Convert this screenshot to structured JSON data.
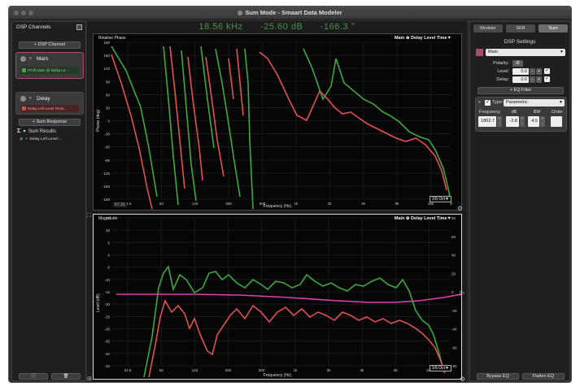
{
  "window": {
    "title": "Sum Mode - Smaart Data Modeler"
  },
  "left_panel": {
    "title": "DSP Channels",
    "add_channel_label": "+ DSP Channel",
    "channels": [
      {
        "name": "Main",
        "source": "(Trsf) Main @ Delay Le...",
        "color": "#3fa83f"
      },
      {
        "name": "Delay",
        "source": "Delay Left Level Timin...",
        "color": "#d64b4b"
      }
    ],
    "add_sum_label": "+ Sum Response",
    "sum_results_label": "Sum Results",
    "sum_item_label": "Delay Left Level ..."
  },
  "readout": {
    "freq": "18.56 kHz",
    "level": "-25.60 dB",
    "phase": "-166.3 °"
  },
  "phase_plot": {
    "label": "Relative Phase",
    "legend": "Main ⊕ Delay Level Time▼",
    "ylabel": "Phase (deg)",
    "xlabel": "Frequency (Hz)",
    "octave": "1/6 Oct▼",
    "cursor_value": "67.33",
    "y_ticks": [
      "180",
      "150",
      "120",
      "90",
      "60",
      "30",
      "0",
      "-30",
      "-60",
      "-90",
      "-120",
      "-150",
      "-180"
    ],
    "x_ticks": [
      "31.5",
      "63",
      "125",
      "250",
      "500",
      "1k",
      "2k",
      "4k",
      "8k",
      "16k"
    ]
  },
  "mag_plot": {
    "label": "Magnitude",
    "legend": "Main ⊕ Delay Level Time▼",
    "ylabel": "Level (dB)",
    "xlabel": "Frequency (Hz)",
    "octave": "1/6 Oct▼",
    "y_ticks": [
      "15",
      "10",
      "5",
      "0",
      "-5",
      "-10",
      "-15",
      "-20",
      "-25",
      "-30",
      "-35",
      "-40",
      "-45"
    ],
    "y2_ticks": [
      "80",
      "60",
      "40",
      "20",
      "0",
      "-20",
      "-40",
      "-60",
      "-80"
    ],
    "x_ticks": [
      "31.5",
      "63",
      "125",
      "250",
      "500",
      "1k",
      "2k",
      "4k",
      "8k",
      "16k"
    ]
  },
  "right_panel": {
    "tabs": [
      "Modeler",
      "SER",
      "Sum"
    ],
    "title": "DSP Settings",
    "channel_select": "Main",
    "channel_color": "#b0486e",
    "polarity_label": "Polarity:",
    "polarity_value": "Ø",
    "level_label": "Level:",
    "level_value": "0.0",
    "delay_label": "Delay:",
    "delay_value": "0.0",
    "add_eq_label": "+ EQ Filter",
    "eq_type_label": "Type:",
    "eq_type_value": "Parametric",
    "eq_headers": [
      "Frequency",
      "dB",
      "BW",
      "Order"
    ],
    "eq_values": [
      "1862.7",
      "-2.8",
      "4.5",
      ""
    ],
    "bypass_label": "Bypass EQ",
    "flatten_label": "Flatten EQ"
  },
  "colors": {
    "green": "#3fa83f",
    "red": "#e05252",
    "pink": "#e040b0"
  }
}
